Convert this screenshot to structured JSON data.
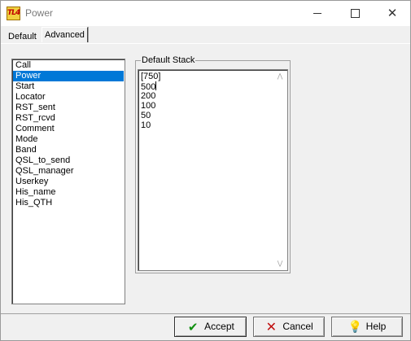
{
  "window": {
    "title": "Power",
    "app_icon_text": "TL4",
    "controls": {
      "minimize": "minimize-icon",
      "maximize": "maximize-icon",
      "close": "close-icon"
    }
  },
  "tabs": [
    {
      "label": "Default",
      "active": false
    },
    {
      "label": "Advanced",
      "active": true
    }
  ],
  "fields": {
    "selected": "Power",
    "items": [
      "Call",
      "Power",
      "Start",
      "Locator",
      "RST_sent",
      "RST_rcvd",
      "Comment",
      "Mode",
      "Band",
      "QSL_to_send",
      "QSL_manager",
      "Userkey",
      "His_name",
      "His_QTH"
    ]
  },
  "default_stack": {
    "label": "Default Stack",
    "lines": [
      "[750]",
      "500",
      "200",
      "100",
      "50",
      "10"
    ]
  },
  "buttons": {
    "accept": "Accept",
    "cancel": "Cancel",
    "help": "Help"
  },
  "colors": {
    "selection": "#0078d7",
    "window_bg": "#f0f0f0",
    "title_text": "#7a7a7a"
  }
}
